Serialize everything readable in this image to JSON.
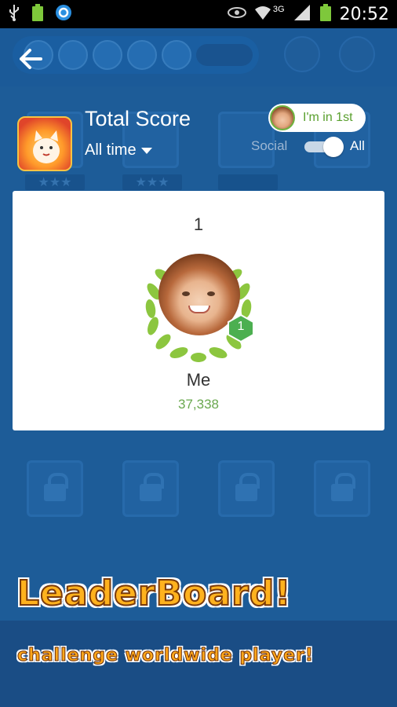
{
  "status_bar": {
    "time": "20:52",
    "network_label": "3G",
    "icons": [
      "usb-icon",
      "battery-full-icon",
      "sync-icon",
      "eye-icon",
      "wifi-icon",
      "signal-icon",
      "battery-icon"
    ]
  },
  "leaderboard": {
    "title": "Total Score",
    "time_filter": "All time",
    "rank_badge_label": "I'm in 1st",
    "toggle_left_label": "Social",
    "toggle_right_label": "All",
    "toggle_selected": "All"
  },
  "entry": {
    "rank": "1",
    "rank_badge_number": "1",
    "name": "Me",
    "score": "37,338"
  },
  "promo": {
    "title": "LeaderBoard!",
    "subtitle": "challenge worldwide player!"
  },
  "colors": {
    "background": "#1d5c98",
    "score_green": "#6aa84f",
    "badge_green": "#4caf50",
    "promo_orange": "#ffb21e"
  }
}
